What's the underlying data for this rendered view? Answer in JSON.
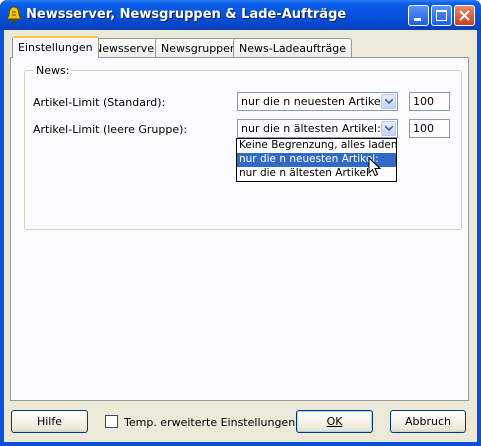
{
  "window": {
    "title": "Newsserver, Newsgruppen & Lade-Aufträge"
  },
  "tabs": [
    {
      "label": "Einstellungen",
      "active": true
    },
    {
      "label": "Newsserver"
    },
    {
      "label": "Newsgruppen"
    },
    {
      "label": "News-Ladeaufträge"
    }
  ],
  "news_group": {
    "legend": "News:",
    "rows": [
      {
        "label": "Artikel-Limit (Standard):",
        "select_value": "nur die n neuesten Artikel:",
        "number": "100"
      },
      {
        "label": "Artikel-Limit (leere Gruppe):",
        "select_value": "nur die n ältesten Artikel:",
        "number": "100"
      }
    ],
    "dropdown_options": [
      {
        "label": "Keine Begrenzung, alles laden"
      },
      {
        "label": "nur die n neuesten Artikel:",
        "highlighted": true
      },
      {
        "label": "nur die n ältesten Artikel:"
      }
    ]
  },
  "footer": {
    "help_label": "Hilfe",
    "checkbox_label": "Temp. erweiterte Einstellungen",
    "checkbox_checked": false,
    "ok_label": "OK",
    "cancel_label": "Abbruch"
  },
  "colors": {
    "titlebar": "#0652dd",
    "dialog_bg": "#ece9d8",
    "selection": "#316ac5"
  }
}
